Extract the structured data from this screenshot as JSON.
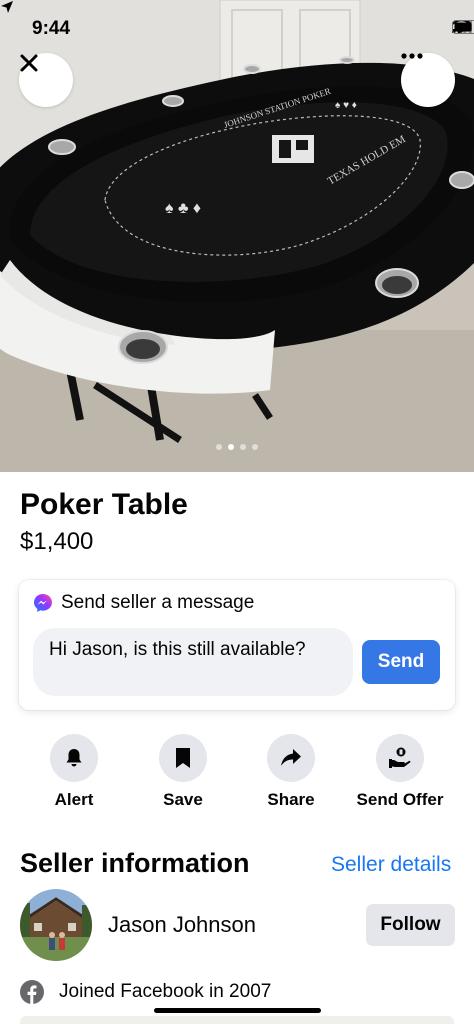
{
  "status_bar": {
    "time": "9:44"
  },
  "photo": {
    "table_text": {
      "brand": "JOHNSON STATION POKER",
      "game": "TEXAS HOLD EM"
    },
    "carousel": {
      "total": 4,
      "active_index": 1
    }
  },
  "listing": {
    "title": "Poker Table",
    "price": "$1,400"
  },
  "message": {
    "header": "Send seller a message",
    "input_value": "Hi Jason, is this still available?",
    "send_label": "Send"
  },
  "actions": [
    {
      "label": "Alert",
      "icon": "bell-icon"
    },
    {
      "label": "Save",
      "icon": "bookmark-icon"
    },
    {
      "label": "Share",
      "icon": "share-arrow-icon"
    },
    {
      "label": "Send Offer",
      "icon": "send-offer-icon"
    }
  ],
  "seller": {
    "section_title": "Seller information",
    "details_link": "Seller details",
    "name": "Jason Johnson",
    "follow_label": "Follow",
    "joined": "Joined Facebook in 2007"
  },
  "colors": {
    "accent": "#1877f2",
    "send_button": "#3578e5",
    "chip_bg": "#e4e6eb",
    "input_bg": "#f0f2f5"
  }
}
